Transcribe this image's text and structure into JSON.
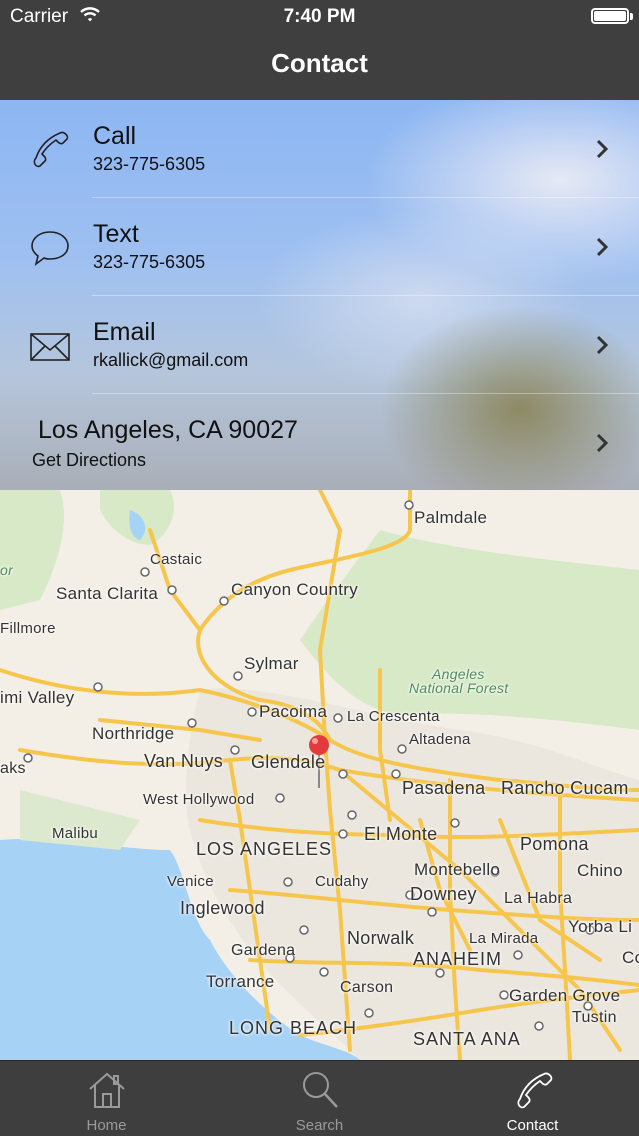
{
  "status": {
    "carrier": "Carrier",
    "time": "7:40 PM"
  },
  "nav": {
    "title": "Contact"
  },
  "contacts": {
    "call": {
      "title": "Call",
      "subtitle": "323-775-6305"
    },
    "text": {
      "title": "Text",
      "subtitle": "323-775-6305"
    },
    "email": {
      "title": "Email",
      "subtitle": "rkallick@gmail.com"
    },
    "address": {
      "title": "Los Angeles, CA 90027",
      "subtitle": "Get Directions"
    }
  },
  "map": {
    "labels": {
      "palmdale": "Palmdale",
      "castaic": "Castaic",
      "santa_clarita": "Santa Clarita",
      "canyon_country": "Canyon Country",
      "fillmore": "Fillmore",
      "sylmar": "Sylmar",
      "simi_valley": "imi Valley",
      "angeles_forest": "Angeles",
      "angeles_forest2": "National Forest",
      "pacoima": "Pacoima",
      "northridge": "Northridge",
      "la_crescenta": "La Crescenta",
      "altadena": "Altadena",
      "van_nuys": "Van Nuys",
      "glendale": "Glendale",
      "oaks": "aks",
      "pasadena": "Pasadena",
      "rancho": "Rancho Cucam",
      "west_hollywood": "West Hollywood",
      "malibu": "Malibu",
      "el_monte": "El Monte",
      "los_angeles": "LOS ANGELES",
      "pomona": "Pomona",
      "montebello": "Montebello",
      "chino": "Chino",
      "venice": "Venice",
      "cudahy": "Cudahy",
      "downey": "Downey",
      "la_habra": "La Habra",
      "inglewood": "Inglewood",
      "yorba": "Yorba Li",
      "norwalk": "Norwalk",
      "la_mirada": "La Mirada",
      "gardena": "Gardena",
      "anaheim": "ANAHEIM",
      "torrance": "Torrance",
      "carson": "Carson",
      "garden_grove": "Garden Grove",
      "tustin": "Tustin",
      "long_beach": "LONG BEACH",
      "santa_ana": "SANTA ANA",
      "or": "or",
      "co": "Co"
    }
  },
  "tabs": [
    {
      "label": "Home",
      "icon": "home-icon",
      "active": false
    },
    {
      "label": "Search",
      "icon": "search-icon",
      "active": false
    },
    {
      "label": "Contact",
      "icon": "phone-icon",
      "active": true
    }
  ],
  "colors": {
    "bar": "#403f40",
    "road": "#f6c64c",
    "water": "#a6d2f5",
    "forest": "#d8e9c8",
    "pin": "#e23b3b"
  }
}
